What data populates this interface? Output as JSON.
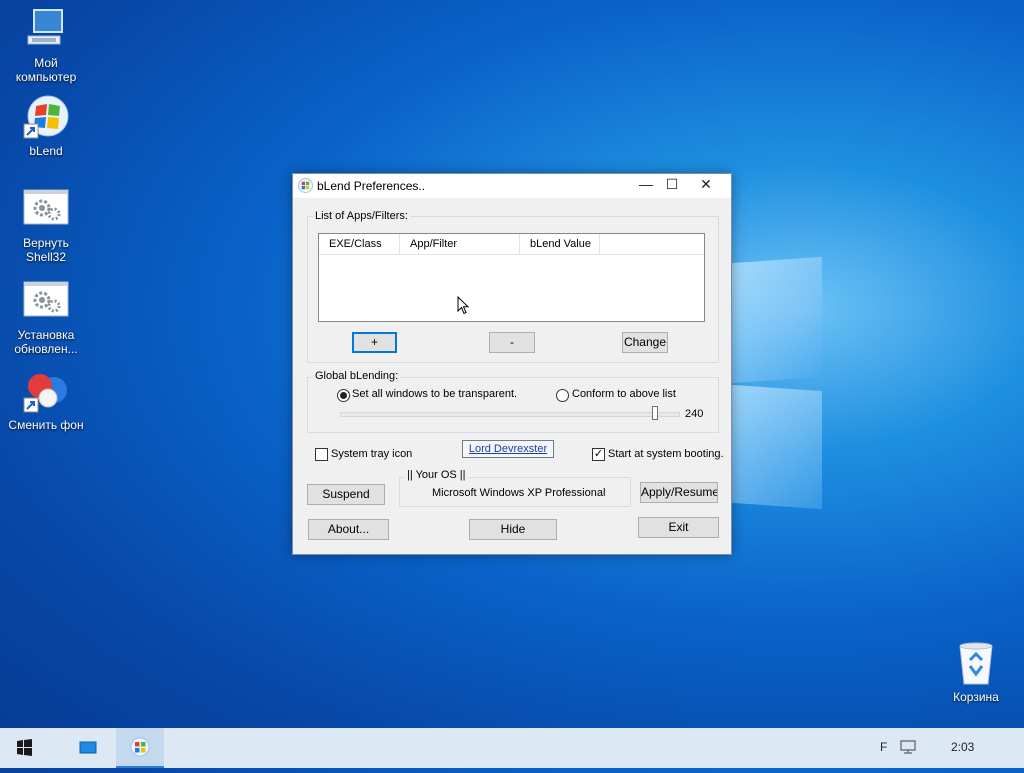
{
  "desktop": {
    "icons": [
      {
        "label": "Мой\nкомпьютер",
        "icon": "computer-icon"
      },
      {
        "label": "bLend",
        "icon": "blend-shortcut-icon"
      },
      {
        "label": "Вернуть\nShell32",
        "icon": "gears-icon"
      },
      {
        "label": "Установка\nобновлен...",
        "icon": "gears-icon"
      },
      {
        "label": "Сменить фон",
        "icon": "balloon-shortcut-icon"
      },
      {
        "label": "Корзина",
        "icon": "recycle-bin-icon"
      }
    ]
  },
  "window": {
    "title": "bLend Preferences..",
    "controls": {
      "minimize": "—",
      "maximize": "☐",
      "close": "✕"
    },
    "apps_group": {
      "label": "List of Apps/Filters:",
      "columns": [
        "EXE/Class",
        "App/Filter",
        "bLend Value"
      ],
      "add_label": "+",
      "remove_label": "-",
      "change_label": "Change"
    },
    "global_group": {
      "label": "Global bLending:",
      "option_all": "Set all windows to be transparent.",
      "option_conform": "Conform to above list",
      "selected": "all",
      "slider_value": "240",
      "slider_max": 255
    },
    "system_tray_label": "System tray icon",
    "system_tray_checked": false,
    "author_link": "Lord Devrexster",
    "start_boot_label": "Start at system booting.",
    "start_boot_checked": true,
    "os_group_label": "|| Your OS ||",
    "os_name": "Microsoft Windows XP Professional",
    "suspend_label": "Suspend",
    "apply_label": "Apply/Resume",
    "about_label": "About...",
    "hide_label": "Hide",
    "exit_label": "Exit"
  },
  "taskbar": {
    "clock": "2:03",
    "lang": "F"
  }
}
